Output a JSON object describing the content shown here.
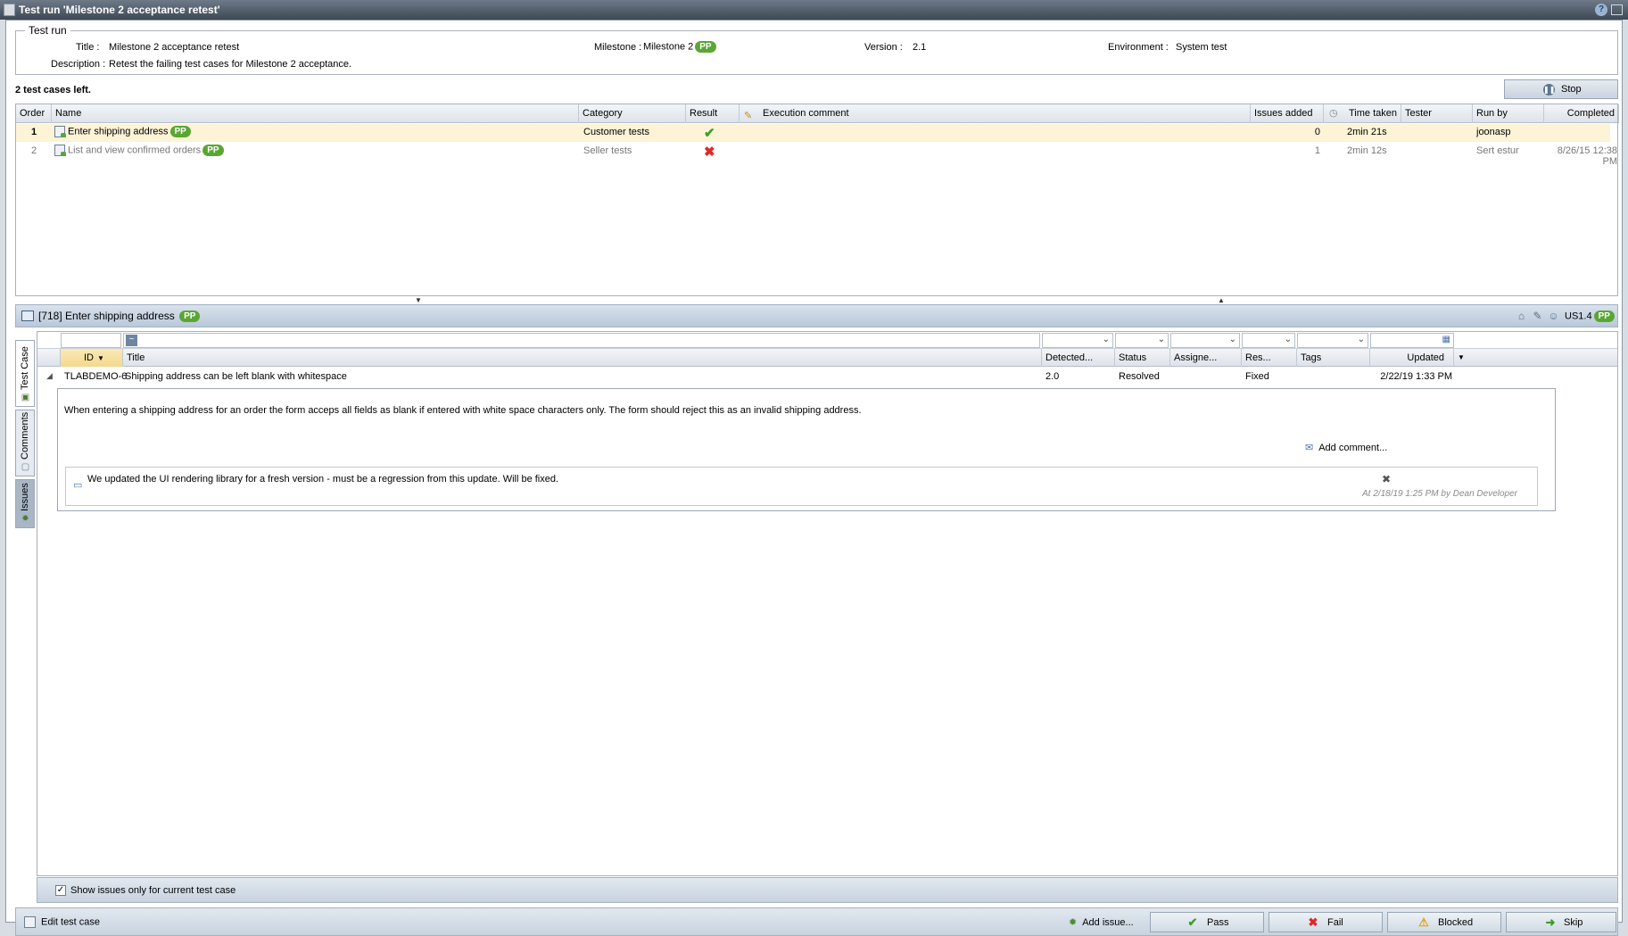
{
  "window": {
    "title": "Test run 'Milestone 2 acceptance retest'",
    "help_icon": "help-icon",
    "minimize_icon": "minimize-icon"
  },
  "testrun": {
    "legend": "Test run",
    "title_label": "Title :",
    "title_value": "Milestone 2 acceptance retest",
    "milestone_label": "Milestone :",
    "milestone_value": "Milestone 2",
    "milestone_badge": "PP",
    "version_label": "Version :",
    "version_value": "2.1",
    "environment_label": "Environment :",
    "environment_value": "System test",
    "description_label": "Description :",
    "description_value": "Retest the failing test cases for Milestone 2 acceptance."
  },
  "status": {
    "cases_left": "2 test cases left.",
    "stop_label": "Stop"
  },
  "grid": {
    "headers": {
      "order": "Order",
      "name": "Name",
      "category": "Category",
      "result": "Result",
      "comment": "Execution comment",
      "issues": "Issues added",
      "time": "Time taken",
      "tester": "Tester",
      "runby": "Run by",
      "completed": "Completed"
    },
    "rows": [
      {
        "order": "1",
        "name": "Enter shipping address",
        "badge": "PP",
        "category": "Customer tests",
        "result": "pass",
        "comment": "",
        "issues": "0",
        "time": "2min 21s",
        "tester": "",
        "runby": "joonasp",
        "completed": ""
      },
      {
        "order": "2",
        "name": "List and view confirmed orders",
        "badge": "PP",
        "category": "Seller tests",
        "result": "fail",
        "comment": "",
        "issues": "1",
        "time": "2min 12s",
        "tester": "",
        "runby": "Sert estur",
        "completed_line1": "8/26/15 12:38",
        "completed_line2": "PM"
      }
    ]
  },
  "detail": {
    "title": "[718] Enter shipping address",
    "badge": "PP",
    "requirement": "US1.4",
    "requirement_badge": "PP"
  },
  "tabs": {
    "test_case": "Test Case",
    "comments": "Comments",
    "issues": "Issues"
  },
  "issues": {
    "filter_symbol": "~",
    "headers": {
      "id": "ID",
      "title": "Title",
      "detected": "Detected...",
      "status": "Status",
      "assignee": "Assigne...",
      "resolution": "Res...",
      "tags": "Tags",
      "updated": "Updated"
    },
    "row": {
      "id": "TLABDEMO-6",
      "title": "Shipping address can be left blank with whitespace",
      "detected": "2.0",
      "status": "Resolved",
      "assignee": "",
      "resolution": "Fixed",
      "tags": "",
      "updated": "2/22/19 1:33 PM"
    },
    "description": "When entering a shipping address for an order the form acceps all fields as blank if entered with white space characters only. The form should reject this as an invalid shipping address.",
    "add_comment": "Add comment...",
    "comment_text": "We updated the UI rendering library for a fresh version - must be a regression from this update. Will be fixed.",
    "comment_meta": "At 2/18/19 1:25 PM by Dean Developer",
    "show_only_current": "Show issues only for current test case"
  },
  "footer": {
    "edit": "Edit test case",
    "add_issue": "Add issue...",
    "pass": "Pass",
    "fail": "Fail",
    "blocked": "Blocked",
    "skip": "Skip"
  },
  "colors": {
    "pass": "#3b9e2c",
    "fail": "#e02727",
    "badge": "#5aa634",
    "selected_row": "#fdf3d6"
  }
}
